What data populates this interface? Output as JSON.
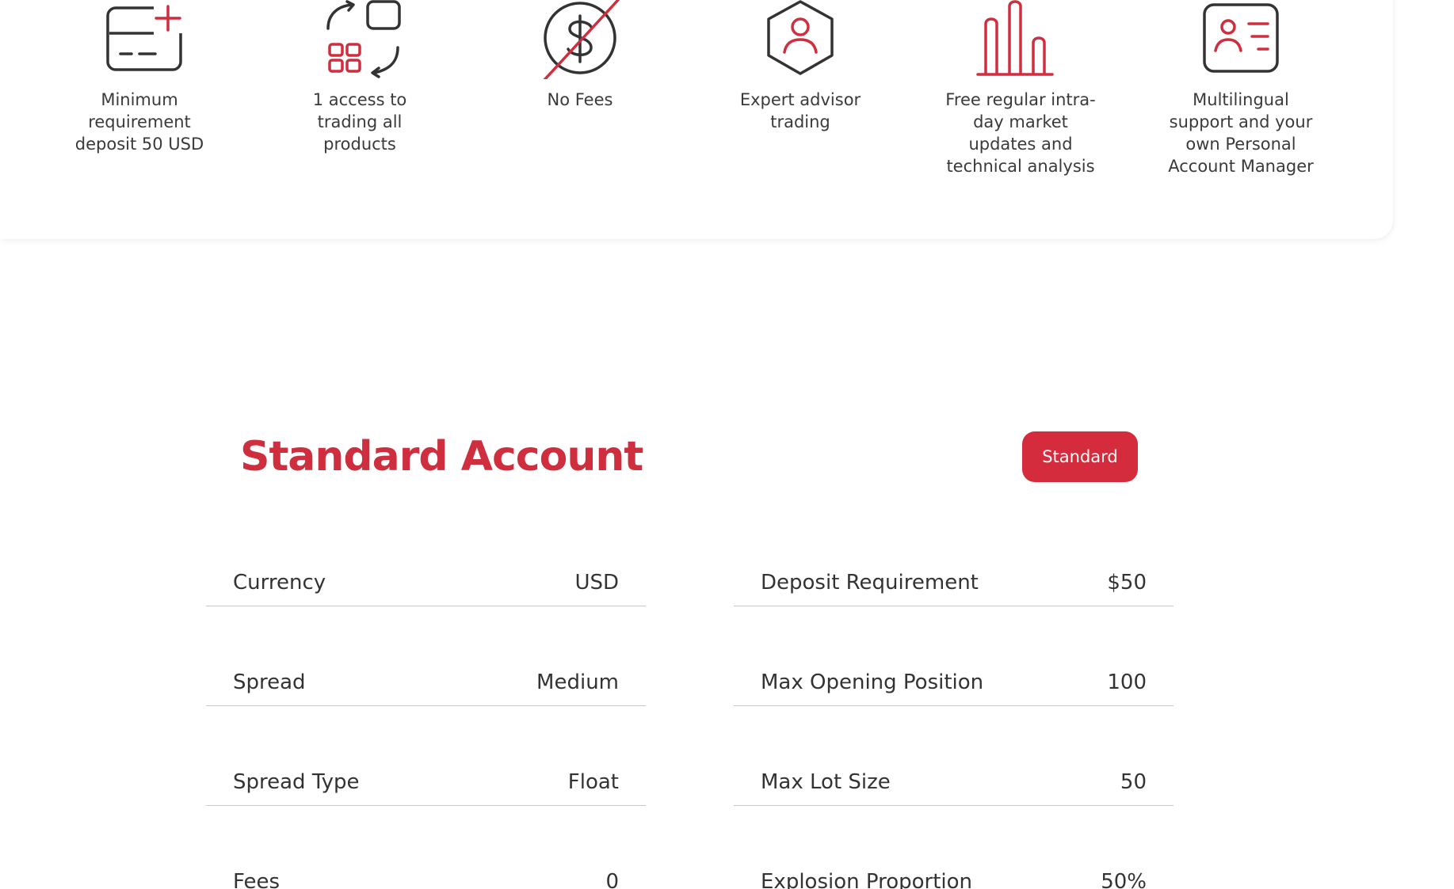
{
  "features": [
    {
      "icon": "card-add-icon",
      "label": "Minimum\nrequirement\ndeposit 50 USD"
    },
    {
      "icon": "exchange-grid-icon",
      "label": "1 access to\ntrading all\nproducts"
    },
    {
      "icon": "no-dollar-icon",
      "label": "No Fees"
    },
    {
      "icon": "user-hexagon-icon",
      "label": "Expert advisor\ntrading"
    },
    {
      "icon": "bar-chart-icon",
      "label": "Free regular intra-\nday market\nupdates and\ntechnical analysis"
    },
    {
      "icon": "contact-card-icon",
      "label": "Multilingual\nsupport and your\nown Personal\nAccount Manager"
    }
  ],
  "account": {
    "title": "Standard Account",
    "badge_label": "Standard"
  },
  "specs": {
    "left": [
      {
        "label": "Currency",
        "value": "USD"
      },
      {
        "label": "Spread",
        "value": "Medium"
      },
      {
        "label": "Spread Type",
        "value": "Float"
      },
      {
        "label": "Fees",
        "value": "0"
      }
    ],
    "right": [
      {
        "label": "Deposit Requirement",
        "value": "$50"
      },
      {
        "label": "Max Opening Position",
        "value": "100"
      },
      {
        "label": "Max Lot Size",
        "value": "50"
      },
      {
        "label": "Explosion Proportion",
        "value": "50%"
      }
    ]
  },
  "colors": {
    "accent": "#d42c3c",
    "icon_dark": "#333333",
    "text": "#3a3a3a",
    "divider": "#c7c7c7"
  }
}
